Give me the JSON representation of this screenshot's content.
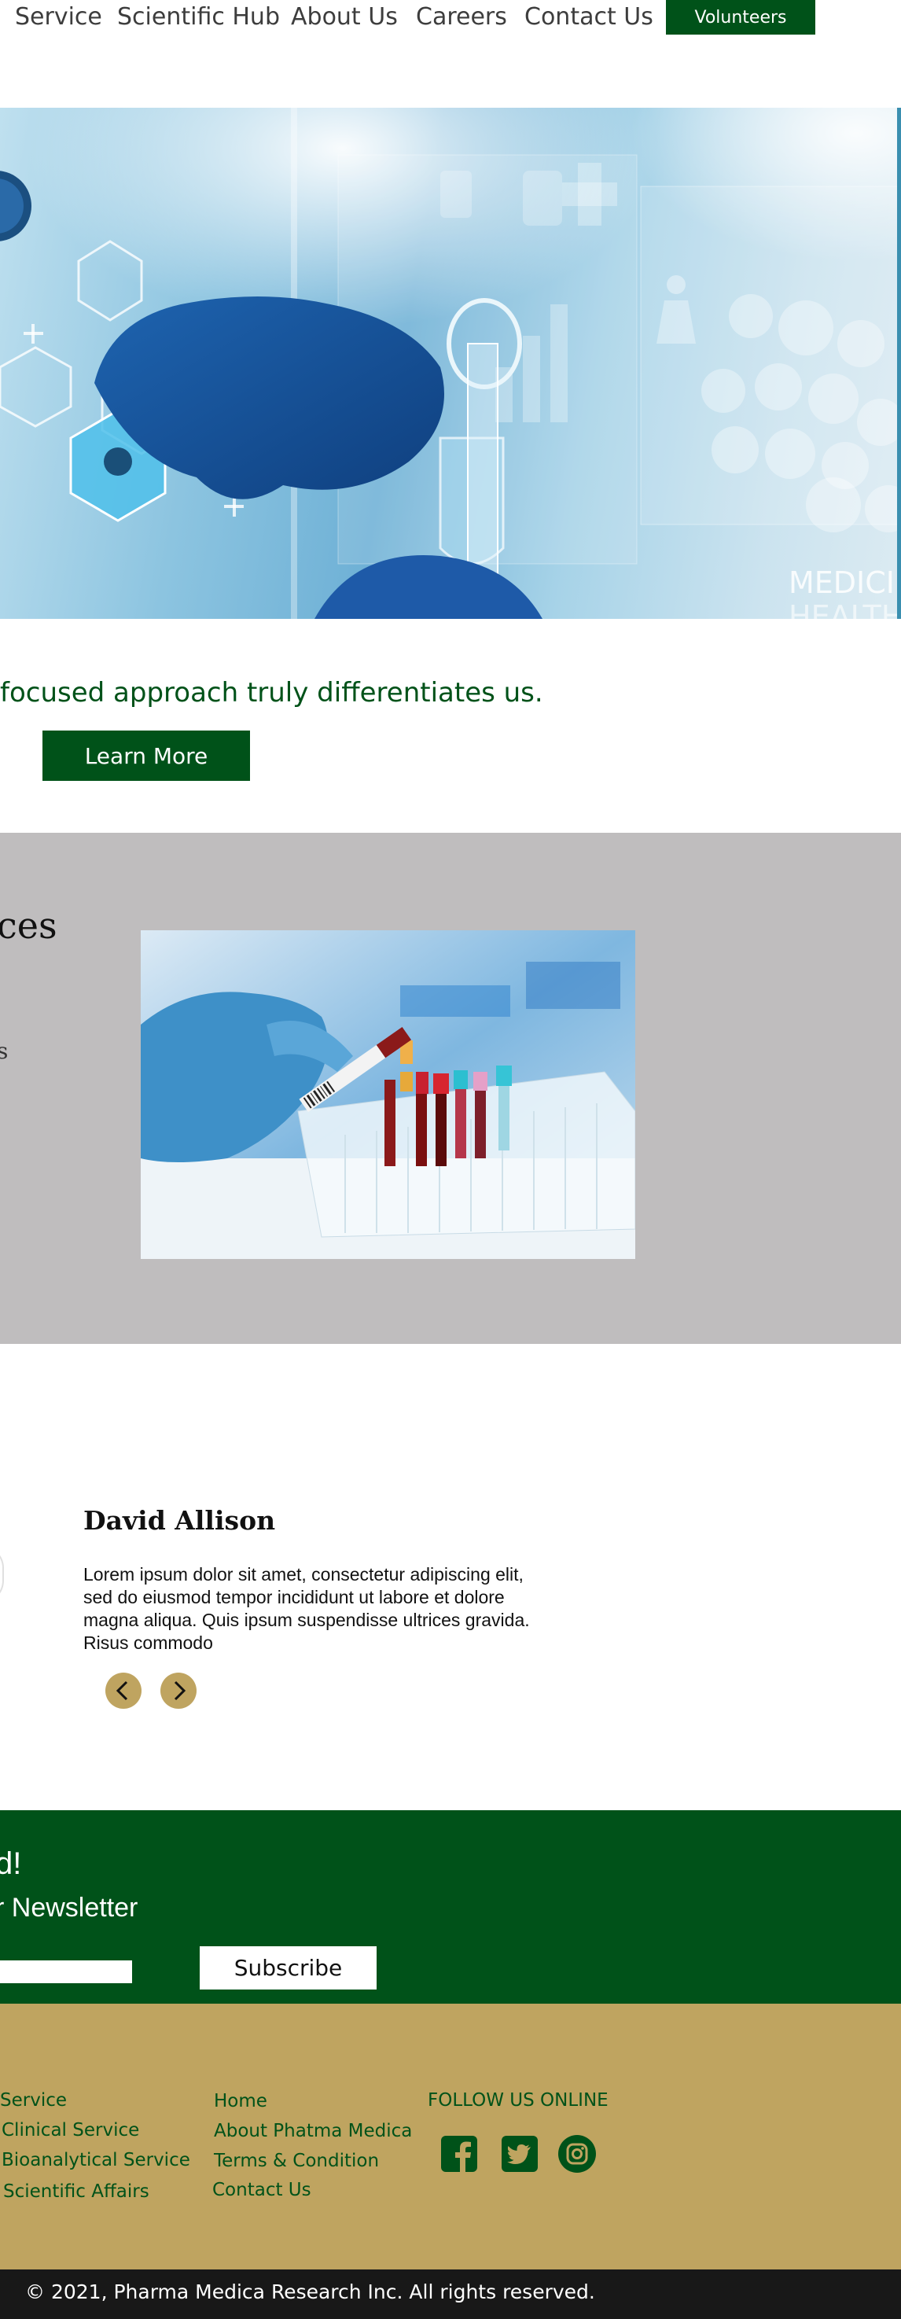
{
  "nav": {
    "items": [
      "Service",
      "Scientific Hub",
      "About Us",
      "Careers",
      "Contact Us"
    ],
    "volunteers_label": "Volunteers"
  },
  "hero": {
    "overlay_texts": [
      "MEDICIN",
      "HEALTH"
    ]
  },
  "intro": {
    "tagline": "focused approach truly differentiates us.",
    "learn_more_label": "Learn More"
  },
  "services": {
    "heading_fragment": "ces",
    "sub_fragment": "s"
  },
  "testimonial": {
    "name": "David Allison",
    "body": "Lorem ipsum dolor sit amet, consectetur adipiscing elit, sed do eiusmod tempor incididunt ut labore et dolore magna aliqua. Quis ipsum suspendisse ultrices gravida. Risus commodo"
  },
  "newsletter": {
    "heading_fragment": "d!",
    "subheading_fragment": "r Newsletter",
    "email_value": "",
    "subscribe_label": "Subscribe"
  },
  "footer": {
    "services": [
      "Service",
      "Clinical Service",
      "Bioanalytical Service",
      "Scientific Affairs"
    ],
    "links": [
      "Home",
      "About Phatma Medica",
      "Terms & Condition",
      "Contact Us"
    ],
    "follow_label": "FOLLOW US ONLINE",
    "social_icons": [
      "facebook-icon",
      "twitter-icon",
      "instagram-icon"
    ],
    "copyright": "© 2021, Pharma Medica Research Inc. All rights reserved."
  },
  "colors": {
    "brand_green": "#005219",
    "gold": "#bfa460",
    "grey_section": "#bfbdbe",
    "dark_bar": "#181818"
  }
}
